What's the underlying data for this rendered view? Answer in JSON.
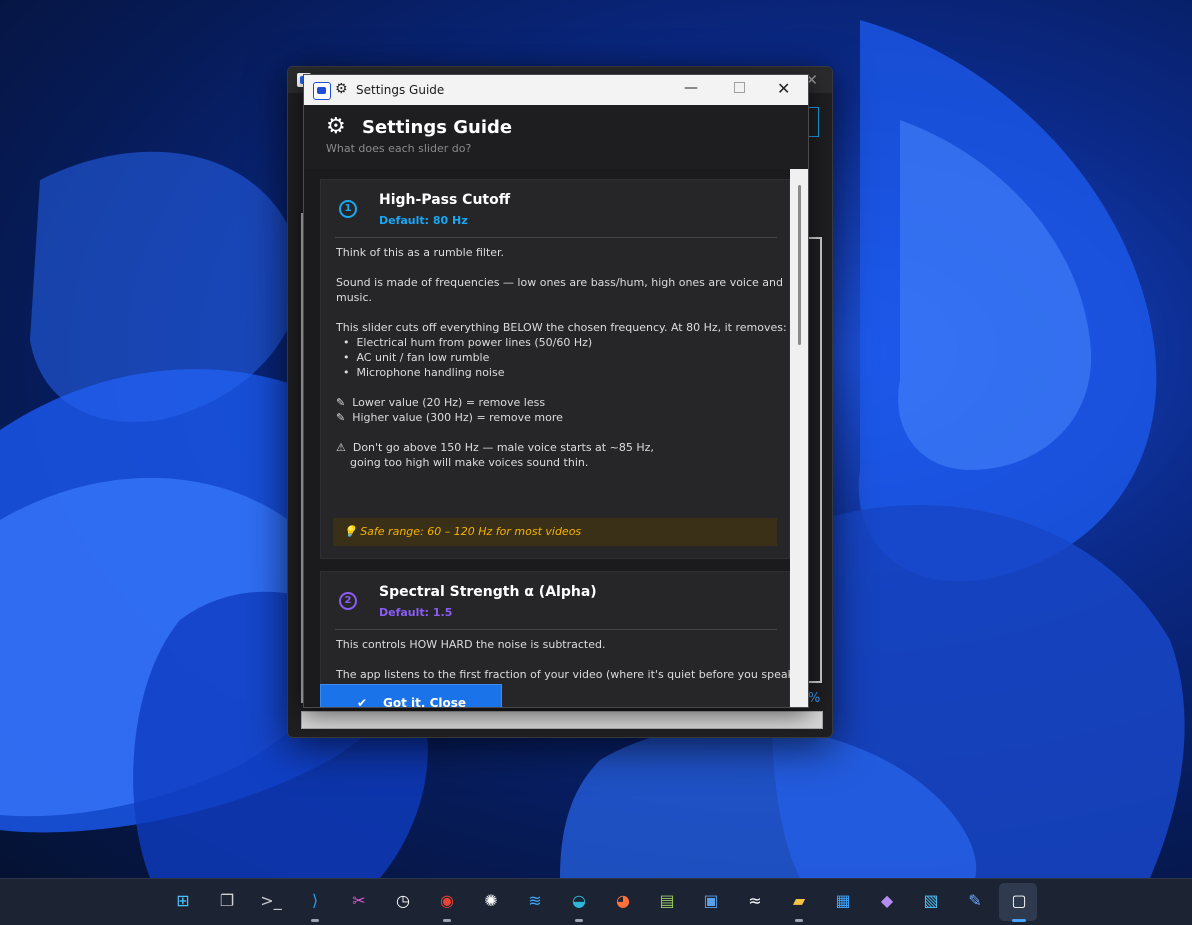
{
  "dialog": {
    "window_title": "Settings Guide",
    "header_title": "Settings Guide",
    "header_subtitle": "What does each slider do?",
    "cards": [
      {
        "number": "1",
        "title": "High-Pass Cutoff",
        "default": "Default: 80 Hz",
        "lines": [
          "Think of this as a rumble filter.",
          "",
          "Sound is made of frequencies — low ones are bass/hum, high ones are voice and",
          "music.",
          "",
          "This slider cuts off everything BELOW the chosen frequency. At 80 Hz, it removes:",
          "  •  Electrical hum from power lines (50/60 Hz)",
          "  •  AC unit / fan low rumble",
          "  •  Microphone handling noise",
          "",
          "✎  Lower value (20 Hz) = remove less",
          "✎  Higher value (300 Hz) = remove more",
          "",
          "⚠  Don't go above 150 Hz — male voice starts at ~85 Hz,",
          "    going too high will make voices sound thin."
        ],
        "tip": "💡  Safe range: 60 – 120 Hz for most videos"
      },
      {
        "number": "2",
        "title": "Spectral Strength  α  (Alpha)",
        "default": "Default: 1.5",
        "lines": [
          "This controls HOW HARD the noise is subtracted.",
          "",
          "The app listens to the first fraction of your video (where it's quiet before you speak)"
        ]
      }
    ],
    "got_it_check": "✔",
    "got_it_label": "Got it, Close"
  },
  "back_window": {
    "percent_fragment": "%"
  },
  "taskbar": {
    "items": [
      {
        "name": "start-icon",
        "glyph": "⊞",
        "color": "#4cc2ff"
      },
      {
        "name": "task-view-icon",
        "glyph": "❐",
        "color": "#d0d0d0"
      },
      {
        "name": "terminal-icon",
        "glyph": ">_",
        "color": "#cccccc"
      },
      {
        "name": "vscode-icon",
        "glyph": "⟩",
        "color": "#2f9cf0"
      },
      {
        "name": "snipping-tool-icon",
        "glyph": "✂",
        "color": "#e05bd6"
      },
      {
        "name": "clock-icon",
        "glyph": "◷",
        "color": "#ffffff"
      },
      {
        "name": "chrome-icon",
        "glyph": "◉",
        "color": "#ea4335"
      },
      {
        "name": "aperture-icon",
        "glyph": "✺",
        "color": "#ffffff"
      },
      {
        "name": "sync-app-icon",
        "glyph": "≋",
        "color": "#3fa9ff"
      },
      {
        "name": "edge-icon",
        "glyph": "◒",
        "color": "#2fb6d9"
      },
      {
        "name": "firefox-icon",
        "glyph": "◕",
        "color": "#ff7139"
      },
      {
        "name": "notepad-icon",
        "glyph": "▤",
        "color": "#9ccc65"
      },
      {
        "name": "remote-desktop-icon",
        "glyph": "▣",
        "color": "#5aa0e6"
      },
      {
        "name": "wifi-analyzer-icon",
        "glyph": "≈",
        "color": "#ffffff"
      },
      {
        "name": "file-explorer-icon",
        "glyph": "▰",
        "color": "#f6c343"
      },
      {
        "name": "store-icon",
        "glyph": "▦",
        "color": "#3ea6ff"
      },
      {
        "name": "visual-studio-icon",
        "glyph": "◆",
        "color": "#b48cf2"
      },
      {
        "name": "screen-capture-icon",
        "glyph": "▧",
        "color": "#4fc3f7"
      },
      {
        "name": "pen-app-icon",
        "glyph": "✎",
        "color": "#6ea8ff"
      },
      {
        "name": "denoiser-app-icon",
        "glyph": "▢",
        "color": "#ffffff"
      }
    ]
  }
}
